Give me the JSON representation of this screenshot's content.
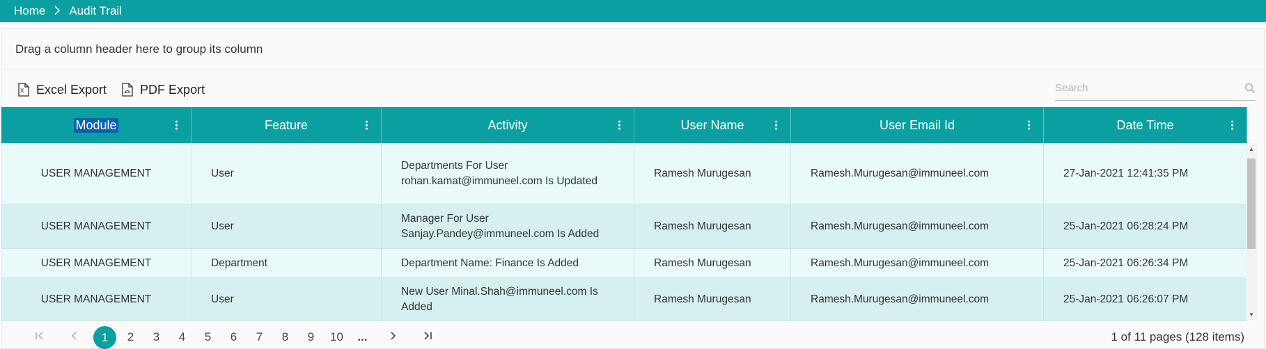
{
  "breadcrumb": {
    "home": "Home",
    "separator": ">",
    "current": "Audit Trail"
  },
  "group_panel": {
    "text": "Drag a column header here to group its column"
  },
  "toolbar": {
    "excel_label": "Excel Export",
    "pdf_label": "PDF Export",
    "search_placeholder": "Search",
    "excel_icon": "excel-file-icon",
    "pdf_icon": "pdf-file-icon",
    "search_icon": "search-icon"
  },
  "columns": [
    "Module",
    "Feature",
    "Activity",
    "User Name",
    "User Email Id",
    "Date Time"
  ],
  "rows": [
    {
      "module": "USER MANAGEMENT",
      "feature": "User",
      "activity": "Departments For User rohan.kamat@immuneel.com Is Updated",
      "user_name": "Ramesh Murugesan",
      "email": "Ramesh.Murugesan@immuneel.com",
      "datetime": "27-Jan-2021 12:41:35 PM"
    },
    {
      "module": "USER MANAGEMENT",
      "feature": "User",
      "activity": "Manager For User Sanjay.Pandey@immuneel.com Is Added",
      "user_name": "Ramesh Murugesan",
      "email": "Ramesh.Murugesan@immuneel.com",
      "datetime": "25-Jan-2021 06:28:24 PM"
    },
    {
      "module": "USER MANAGEMENT",
      "feature": "Department",
      "activity": "Department Name: Finance Is Added",
      "user_name": "Ramesh Murugesan",
      "email": "Ramesh.Murugesan@immuneel.com",
      "datetime": "25-Jan-2021 06:26:34 PM"
    },
    {
      "module": "USER MANAGEMENT",
      "feature": "User",
      "activity": "New User Minal.Shah@immuneel.com Is Added",
      "user_name": "Ramesh Murugesan",
      "email": "Ramesh.Murugesan@immuneel.com",
      "datetime": "25-Jan-2021 06:26:07 PM"
    }
  ],
  "pager": {
    "pages": [
      "1",
      "2",
      "3",
      "4",
      "5",
      "6",
      "7",
      "8",
      "9",
      "10",
      "..."
    ],
    "current": "1",
    "info": "1 of 11 pages (128 items)",
    "first_icon": "first-page-icon",
    "prev_icon": "previous-page-icon",
    "next_icon": "next-page-icon",
    "last_icon": "last-page-icon"
  },
  "colors": {
    "accent": "#0a9fa0",
    "row_odd": "#e9fafa",
    "row_even": "#d5f0ef"
  }
}
